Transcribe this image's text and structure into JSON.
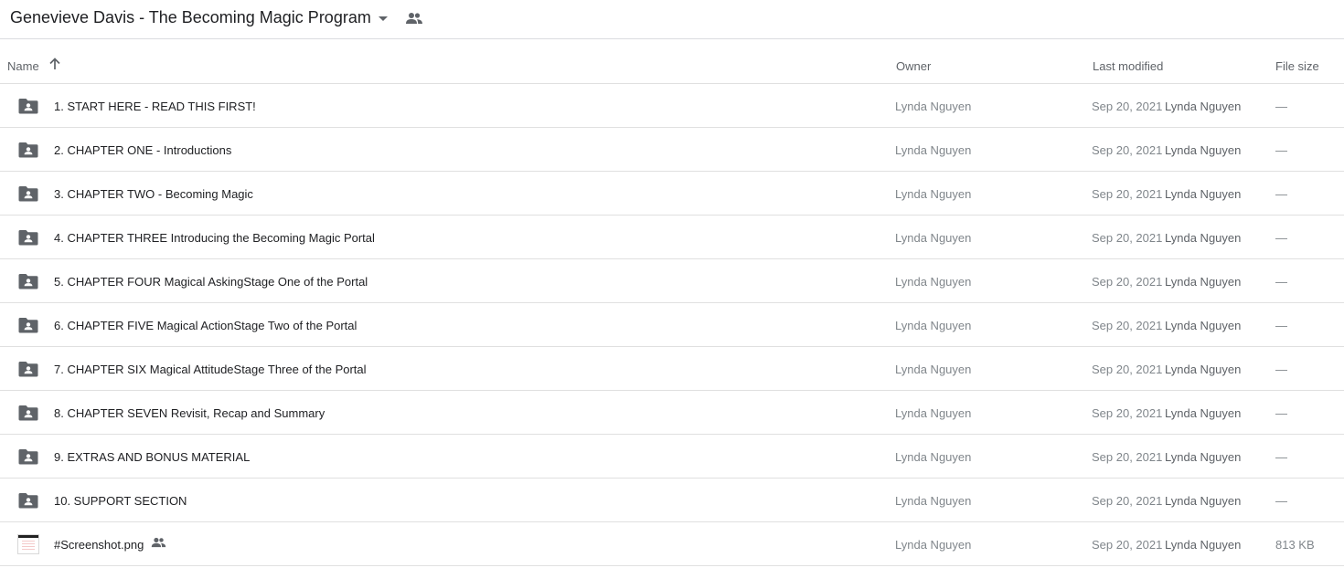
{
  "header": {
    "folder_title": "Genevieve Davis - The Becoming Magic Program",
    "dropdown_icon": "caret-down-icon",
    "shared_icon": "people-icon"
  },
  "columns": {
    "name": "Name",
    "sort_icon": "arrow-up-icon",
    "owner": "Owner",
    "last_modified": "Last modified",
    "file_size": "File size"
  },
  "colors": {
    "text_primary": "#202124",
    "text_secondary": "#80868b",
    "icon": "#5f6368",
    "divider": "#e0e0e0"
  },
  "rows": [
    {
      "type": "shared-folder",
      "name": "1. START HERE - READ THIS FIRST!",
      "owner": "Lynda Nguyen",
      "date": "Sep 20, 2021",
      "modified_by": "Lynda Nguyen",
      "size": "—"
    },
    {
      "type": "shared-folder",
      "name": "2. CHAPTER ONE - Introductions",
      "owner": "Lynda Nguyen",
      "date": "Sep 20, 2021",
      "modified_by": "Lynda Nguyen",
      "size": "—"
    },
    {
      "type": "shared-folder",
      "name": "3. CHAPTER TWO - Becoming Magic",
      "owner": "Lynda Nguyen",
      "date": "Sep 20, 2021",
      "modified_by": "Lynda Nguyen",
      "size": "—"
    },
    {
      "type": "shared-folder",
      "name": "4. CHAPTER THREE Introducing the Becoming Magic Portal",
      "owner": "Lynda Nguyen",
      "date": "Sep 20, 2021",
      "modified_by": "Lynda Nguyen",
      "size": "—"
    },
    {
      "type": "shared-folder",
      "name": "5. CHAPTER FOUR Magical AskingStage One of the Portal",
      "owner": "Lynda Nguyen",
      "date": "Sep 20, 2021",
      "modified_by": "Lynda Nguyen",
      "size": "—"
    },
    {
      "type": "shared-folder",
      "name": "6. CHAPTER FIVE Magical ActionStage Two of the Portal",
      "owner": "Lynda Nguyen",
      "date": "Sep 20, 2021",
      "modified_by": "Lynda Nguyen",
      "size": "—"
    },
    {
      "type": "shared-folder",
      "name": "7. CHAPTER SIX Magical AttitudeStage Three of the Portal",
      "owner": "Lynda Nguyen",
      "date": "Sep 20, 2021",
      "modified_by": "Lynda Nguyen",
      "size": "—"
    },
    {
      "type": "shared-folder",
      "name": "8. CHAPTER SEVEN Revisit, Recap and Summary",
      "owner": "Lynda Nguyen",
      "date": "Sep 20, 2021",
      "modified_by": "Lynda Nguyen",
      "size": "—"
    },
    {
      "type": "shared-folder",
      "name": "9. EXTRAS AND BONUS MATERIAL",
      "owner": "Lynda Nguyen",
      "date": "Sep 20, 2021",
      "modified_by": "Lynda Nguyen",
      "size": "—"
    },
    {
      "type": "shared-folder",
      "name": "10. SUPPORT SECTION",
      "owner": "Lynda Nguyen",
      "date": "Sep 20, 2021",
      "modified_by": "Lynda Nguyen",
      "size": "—"
    },
    {
      "type": "image-file",
      "name": "#Screenshot.png",
      "shared": true,
      "owner": "Lynda Nguyen",
      "date": "Sep 20, 2021",
      "modified_by": "Lynda Nguyen",
      "size": "813 KB"
    }
  ]
}
